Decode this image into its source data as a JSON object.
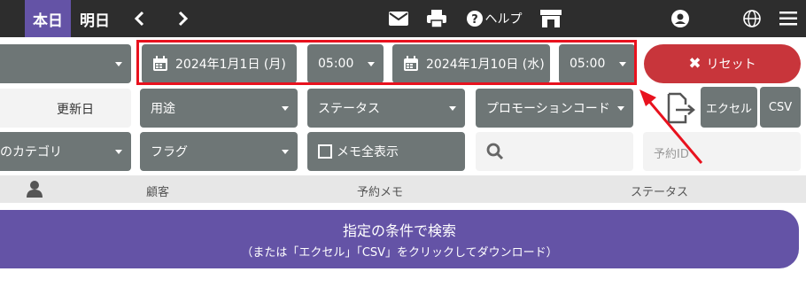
{
  "topbar": {
    "today": "本日",
    "tomorrow": "明日",
    "help": "ヘルプ"
  },
  "filters": {
    "category_partial": "のカテゴリ",
    "start_date": "2024年1月1日 (月)",
    "start_time": "05:00",
    "end_date": "2024年1月10日 (水)",
    "end_time": "05:00",
    "updated_date": "更新日",
    "usage": "用途",
    "status": "ステータス",
    "promo_code": "プロモーションコード",
    "flag": "フラグ",
    "show_all_memo": "メモ全表示",
    "reservation_id_placeholder": "予約ID"
  },
  "actions": {
    "reset": "リセット",
    "excel": "エクセル",
    "csv": "CSV"
  },
  "table_header": {
    "customer": "顧客",
    "reservation_memo": "予約メモ",
    "status": "ステータス"
  },
  "search": {
    "main": "指定の条件で検索",
    "sub": "（または「エクセル」「CSV」をクリックしてダウンロード）"
  },
  "colors": {
    "accent": "#6453a6",
    "reset": "#c8353b",
    "highlight": "#e8121e",
    "dropdown": "#6e7676"
  }
}
